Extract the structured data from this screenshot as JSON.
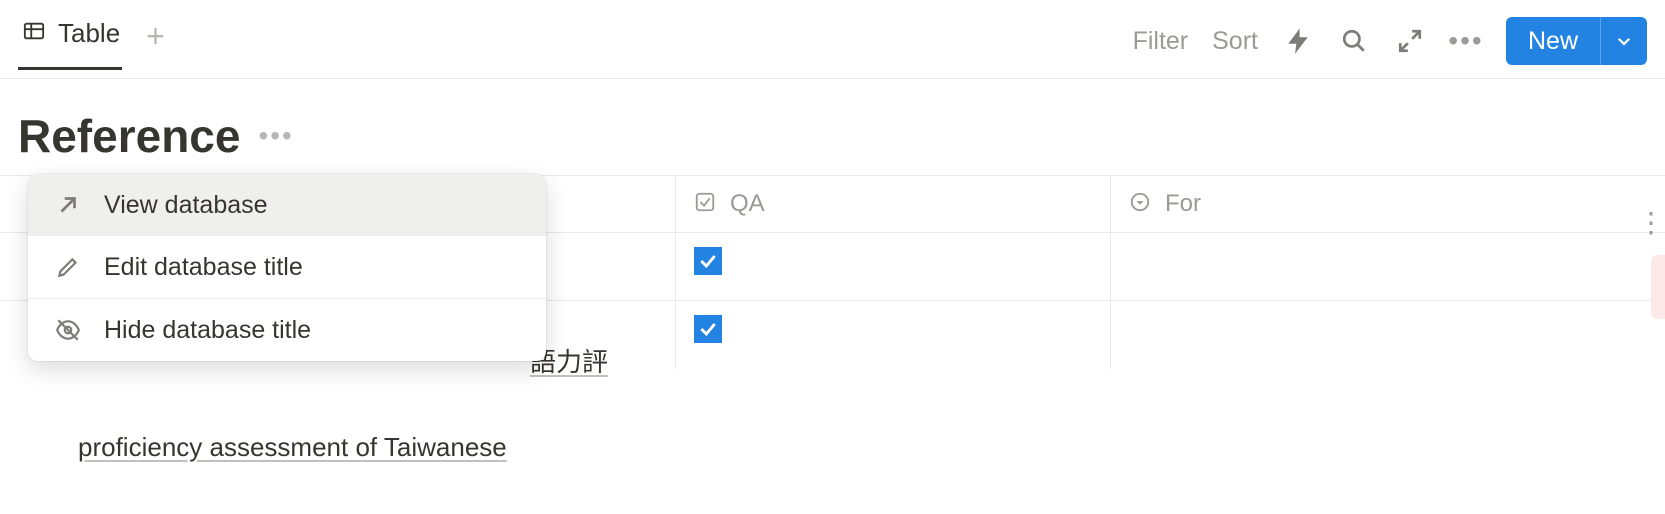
{
  "toolbar": {
    "tab_label": "Table",
    "filter_label": "Filter",
    "sort_label": "Sort",
    "new_label": "New"
  },
  "database": {
    "title": "Reference"
  },
  "columns": {
    "qa_label": "QA",
    "for_label": "For"
  },
  "rows": [
    {
      "title_visible": "",
      "qa_checked": true,
      "for": ""
    },
    {
      "title_partial_right": "語力評",
      "title_below": "proficiency assessment of Taiwanese",
      "qa_checked": true,
      "for": ""
    }
  ],
  "context_menu": {
    "items": [
      {
        "label": "View database",
        "hovered": true
      },
      {
        "label": "Edit database title",
        "hovered": false
      },
      {
        "label": "Hide database title",
        "hovered": false
      }
    ]
  }
}
